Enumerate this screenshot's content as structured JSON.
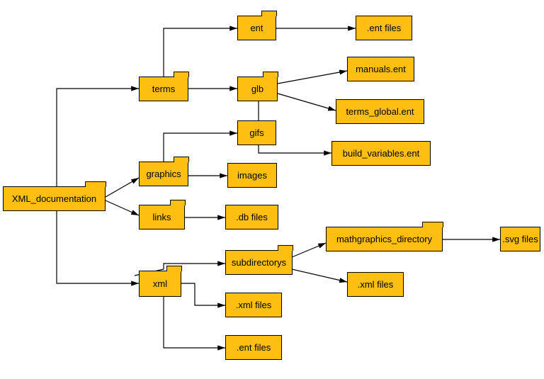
{
  "nodes": {
    "root": "XML_documentation",
    "terms": "terms",
    "graphics": "graphics",
    "links": "links",
    "xml": "xml",
    "ent": "ent",
    "glb": "glb",
    "gifs": "gifs",
    "images": "images",
    "dbfiles": ".db files",
    "subdirs": "subdirectorys",
    "xmlfiles1": ".xml files",
    "entfiles1": ".ent files",
    "entfiles0": ".ent files",
    "manuals": "manuals.ent",
    "termsglobal": "terms_global.ent",
    "buildvars": "build_variables.ent",
    "mathgraphics": "mathgraphics_directory",
    "xmlfiles2": ".xml files",
    "svgfiles": ".svg files"
  }
}
